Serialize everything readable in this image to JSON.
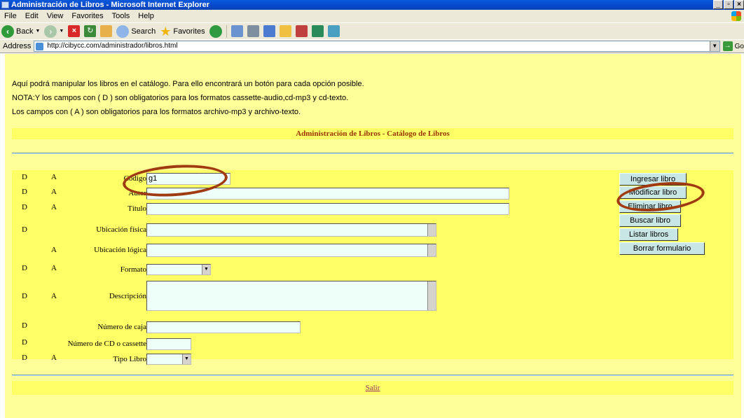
{
  "window": {
    "title": "Administración de Libros - Microsoft Internet Explorer"
  },
  "menu": [
    "File",
    "Edit",
    "View",
    "Favorites",
    "Tools",
    "Help"
  ],
  "toolbar": {
    "back_label": "Back",
    "search_label": "Search",
    "favorites_label": "Favorites"
  },
  "address": {
    "label": "Address",
    "url": "http://cibycc.com/administrador/libros.html",
    "go_label": "Go"
  },
  "intro": {
    "line1": "Aquí podrá manipular los libros en el catálogo. Para ello encontrará un botón para cada opción posible.",
    "line2": "NOTA:Y los campos con ( D ) son obligatorios para los formatos cassette-audio,cd-mp3 y cd-texto.",
    "line3": "Los campos con ( A ) son obligatorios para los formatos archivo-mp3 y archivo-texto."
  },
  "section_title": "Administración de Libros - Catálogo de Libros",
  "form": {
    "rows": [
      {
        "d": "D",
        "a": "A",
        "label": "Código",
        "value": "g1"
      },
      {
        "d": "D",
        "a": "A",
        "label": "Autor",
        "value": ""
      },
      {
        "d": "D",
        "a": "A",
        "label": "Título",
        "value": ""
      },
      {
        "d": "D",
        "a": "",
        "label": "Ubicación física",
        "value": ""
      },
      {
        "d": "",
        "a": "A",
        "label": "Ubicación lógica",
        "value": ""
      },
      {
        "d": "D",
        "a": "A",
        "label": "Formato",
        "value": ""
      },
      {
        "d": "D",
        "a": "A",
        "label": "Descripción",
        "value": ""
      },
      {
        "d": "D",
        "a": "",
        "label": "Número de caja",
        "value": ""
      },
      {
        "d": "D",
        "a": "",
        "label": "Número de CD o cassette",
        "value": ""
      },
      {
        "d": "D",
        "a": "A",
        "label": "Tipo Libro",
        "value": ""
      }
    ]
  },
  "buttons": {
    "ingresar": "Ingresar libro",
    "modificar": "Modificar libro",
    "eliminar": "Eliminar libro",
    "buscar": "Buscar libro",
    "listar": "Listar libros",
    "borrar": "Borrar formulario"
  },
  "footer": {
    "salir": "Salir"
  },
  "colors": {
    "page_bg": "#ffff99",
    "band_bg": "#ffff66",
    "title_text": "#993300",
    "button_bg": "#c8e6e4",
    "annotation": "#a03a10"
  }
}
